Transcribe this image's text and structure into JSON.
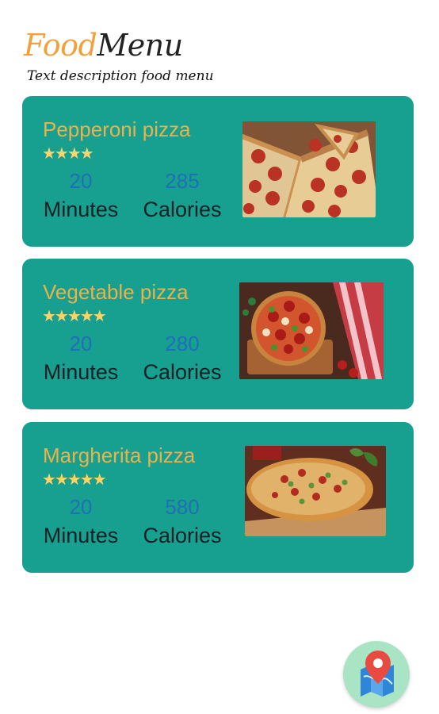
{
  "header": {
    "title_food": "Food",
    "title_menu": "Menu",
    "subtitle": "Text description food menu"
  },
  "menu": [
    {
      "name": "Pepperoni pizza",
      "stars": "★★★★",
      "rating": 4,
      "minutes": "20",
      "minutes_label": "Minutes",
      "calories": "285",
      "calories_label": "Calories",
      "image_icon": "pepperoni-pizza-image"
    },
    {
      "name": "Vegetable pizza",
      "stars": "★★★★★",
      "rating": 5,
      "minutes": "20",
      "minutes_label": "Minutes",
      "calories": "280",
      "calories_label": "Calories",
      "image_icon": "vegetable-pizza-image"
    },
    {
      "name": "Margherita pizza",
      "stars": "★★★★★",
      "rating": 5,
      "minutes": "20",
      "minutes_label": "Minutes",
      "calories": "580",
      "calories_label": "Calories",
      "image_icon": "margherita-pizza-image"
    }
  ],
  "fab": {
    "icon": "map-location-icon"
  },
  "colors": {
    "card_bg": "#17a08f",
    "title_food": "#f3a03a",
    "item_name": "#ebb14a",
    "star": "#ffd36a",
    "stat_value": "#1f6fb7",
    "stat_label": "#0f2026",
    "fab_bg": "#a9e4c5"
  }
}
